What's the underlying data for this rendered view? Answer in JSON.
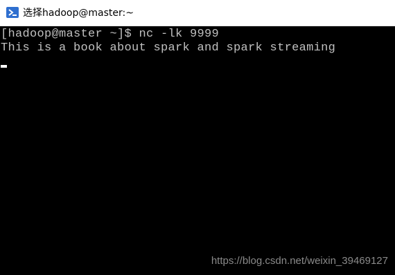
{
  "window": {
    "title": "选择hadoop@master:~",
    "icon": "powershell-terminal-icon"
  },
  "terminal": {
    "lines": [
      "[hadoop@master ~]$ nc -lk 9999",
      "This is a book about spark and spark streaming"
    ],
    "cursor": "block-cursor"
  },
  "watermark": {
    "text": "https://blog.csdn.net/weixin_39469127"
  },
  "colors": {
    "background": "#000000",
    "text": "#c0c0c0",
    "titlebar": "#ffffff",
    "icon_blue": "#2f6fcf"
  }
}
